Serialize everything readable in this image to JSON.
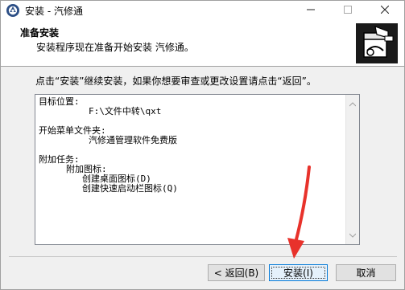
{
  "window": {
    "title": "安装 - 汽修通",
    "icon": "app-logo-icon",
    "controls": {
      "minimize": "minimize-icon",
      "maximize": "maximize-icon",
      "close": "close-icon"
    }
  },
  "header": {
    "title": "准备安装",
    "subtitle": "安装程序现在准备开始安装 汽修通。",
    "logo": "installer-logo-icon"
  },
  "instruction": "点击“安装”继续安装，如果你想要审查或更改设置请点击“返回”。",
  "memo": {
    "lines": [
      "目标位置:",
      "F:\\文件中转\\qxt",
      "",
      "开始菜单文件夹:",
      "汽修通管理软件免费版",
      "",
      "附加任务:",
      "附加图标:",
      "创建桌面图标(D)",
      "创建快速启动栏图标(Q)"
    ]
  },
  "buttons": {
    "back": "< 返回(B)",
    "install": "安装(I)",
    "cancel": "取消"
  },
  "colors": {
    "accent": "#0078d7",
    "annotation_arrow": "#e8322b",
    "window_bg": "#f0f0f0"
  }
}
